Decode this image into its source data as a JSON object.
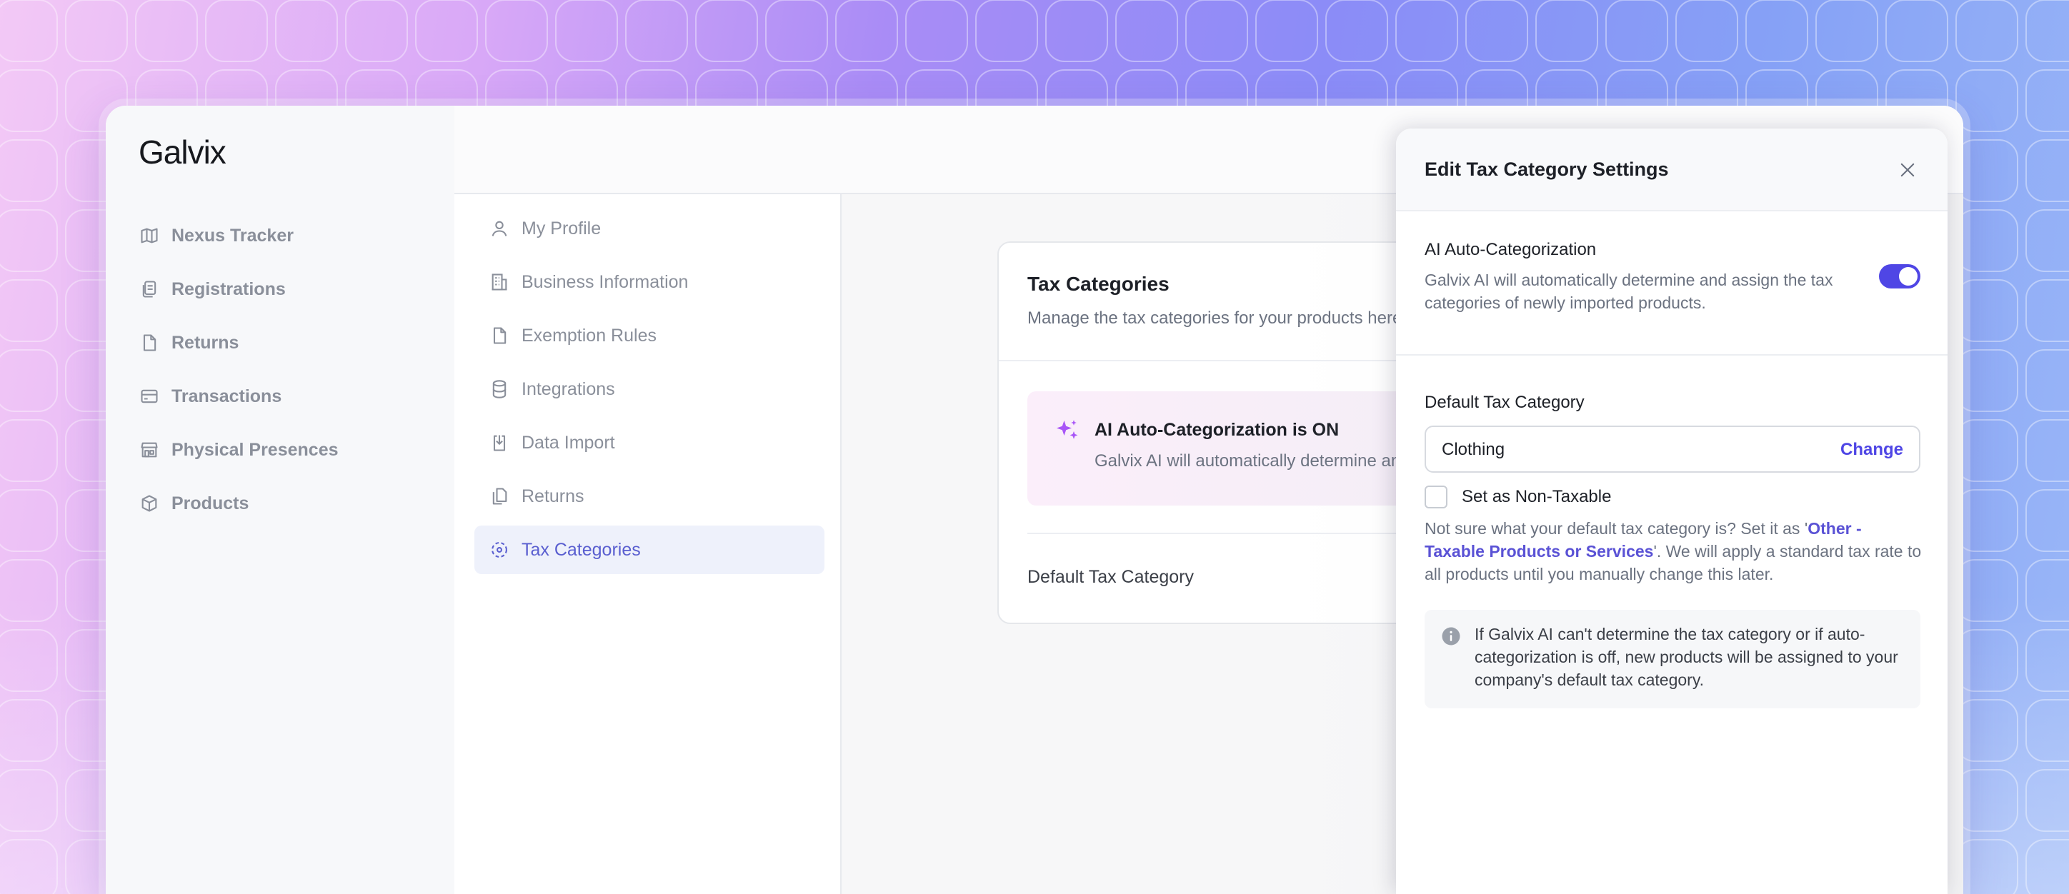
{
  "app": {
    "logo": "Galvix"
  },
  "sidebar": {
    "items": [
      {
        "label": "Nexus Tracker",
        "icon": "map-icon"
      },
      {
        "label": "Registrations",
        "icon": "documents-icon"
      },
      {
        "label": "Returns",
        "icon": "file-icon"
      },
      {
        "label": "Transactions",
        "icon": "credit-card-icon"
      },
      {
        "label": "Physical Presences",
        "icon": "store-icon"
      },
      {
        "label": "Products",
        "icon": "box-icon"
      }
    ]
  },
  "settings_nav": {
    "items": [
      {
        "label": "My Profile",
        "icon": "user-icon"
      },
      {
        "label": "Business Information",
        "icon": "building-icon"
      },
      {
        "label": "Exemption Rules",
        "icon": "file-icon"
      },
      {
        "label": "Integrations",
        "icon": "database-icon"
      },
      {
        "label": "Data Import",
        "icon": "download-icon"
      },
      {
        "label": "Returns",
        "icon": "copy-icon"
      },
      {
        "label": "Tax Categories",
        "icon": "dashed-circle-icon",
        "active": true
      }
    ]
  },
  "main": {
    "card_title": "Tax Categories",
    "card_subtitle": "Manage the tax categories for your products here",
    "banner_title": "AI Auto-Categorization is ON",
    "banner_text": "Galvix AI will automatically determine and assign th",
    "default_label": "Default Tax Category"
  },
  "panel": {
    "title": "Edit Tax Category Settings",
    "ai_title": "AI Auto-Categorization",
    "ai_desc": "Galvix AI will automatically determine and assign the tax categories of newly imported products.",
    "ai_enabled": true,
    "default_title": "Default Tax Category",
    "default_value": "Clothing",
    "change_label": "Change",
    "non_taxable_label": "Set as Non-Taxable",
    "non_taxable_checked": false,
    "hint_prefix": "Not sure what your default tax category is? Set it as '",
    "hint_link": "Other - Taxable Products or Services",
    "hint_suffix": "'. We will apply a standard tax rate to all products until you manually change this later.",
    "info_text": "If Galvix AI can't determine the tax category or if auto-categorization is off, new products will be assigned to your company's default tax category."
  },
  "colors": {
    "accent": "#4f46e5",
    "active_bg": "#eef1fb",
    "text_muted": "#8a8f9a"
  }
}
